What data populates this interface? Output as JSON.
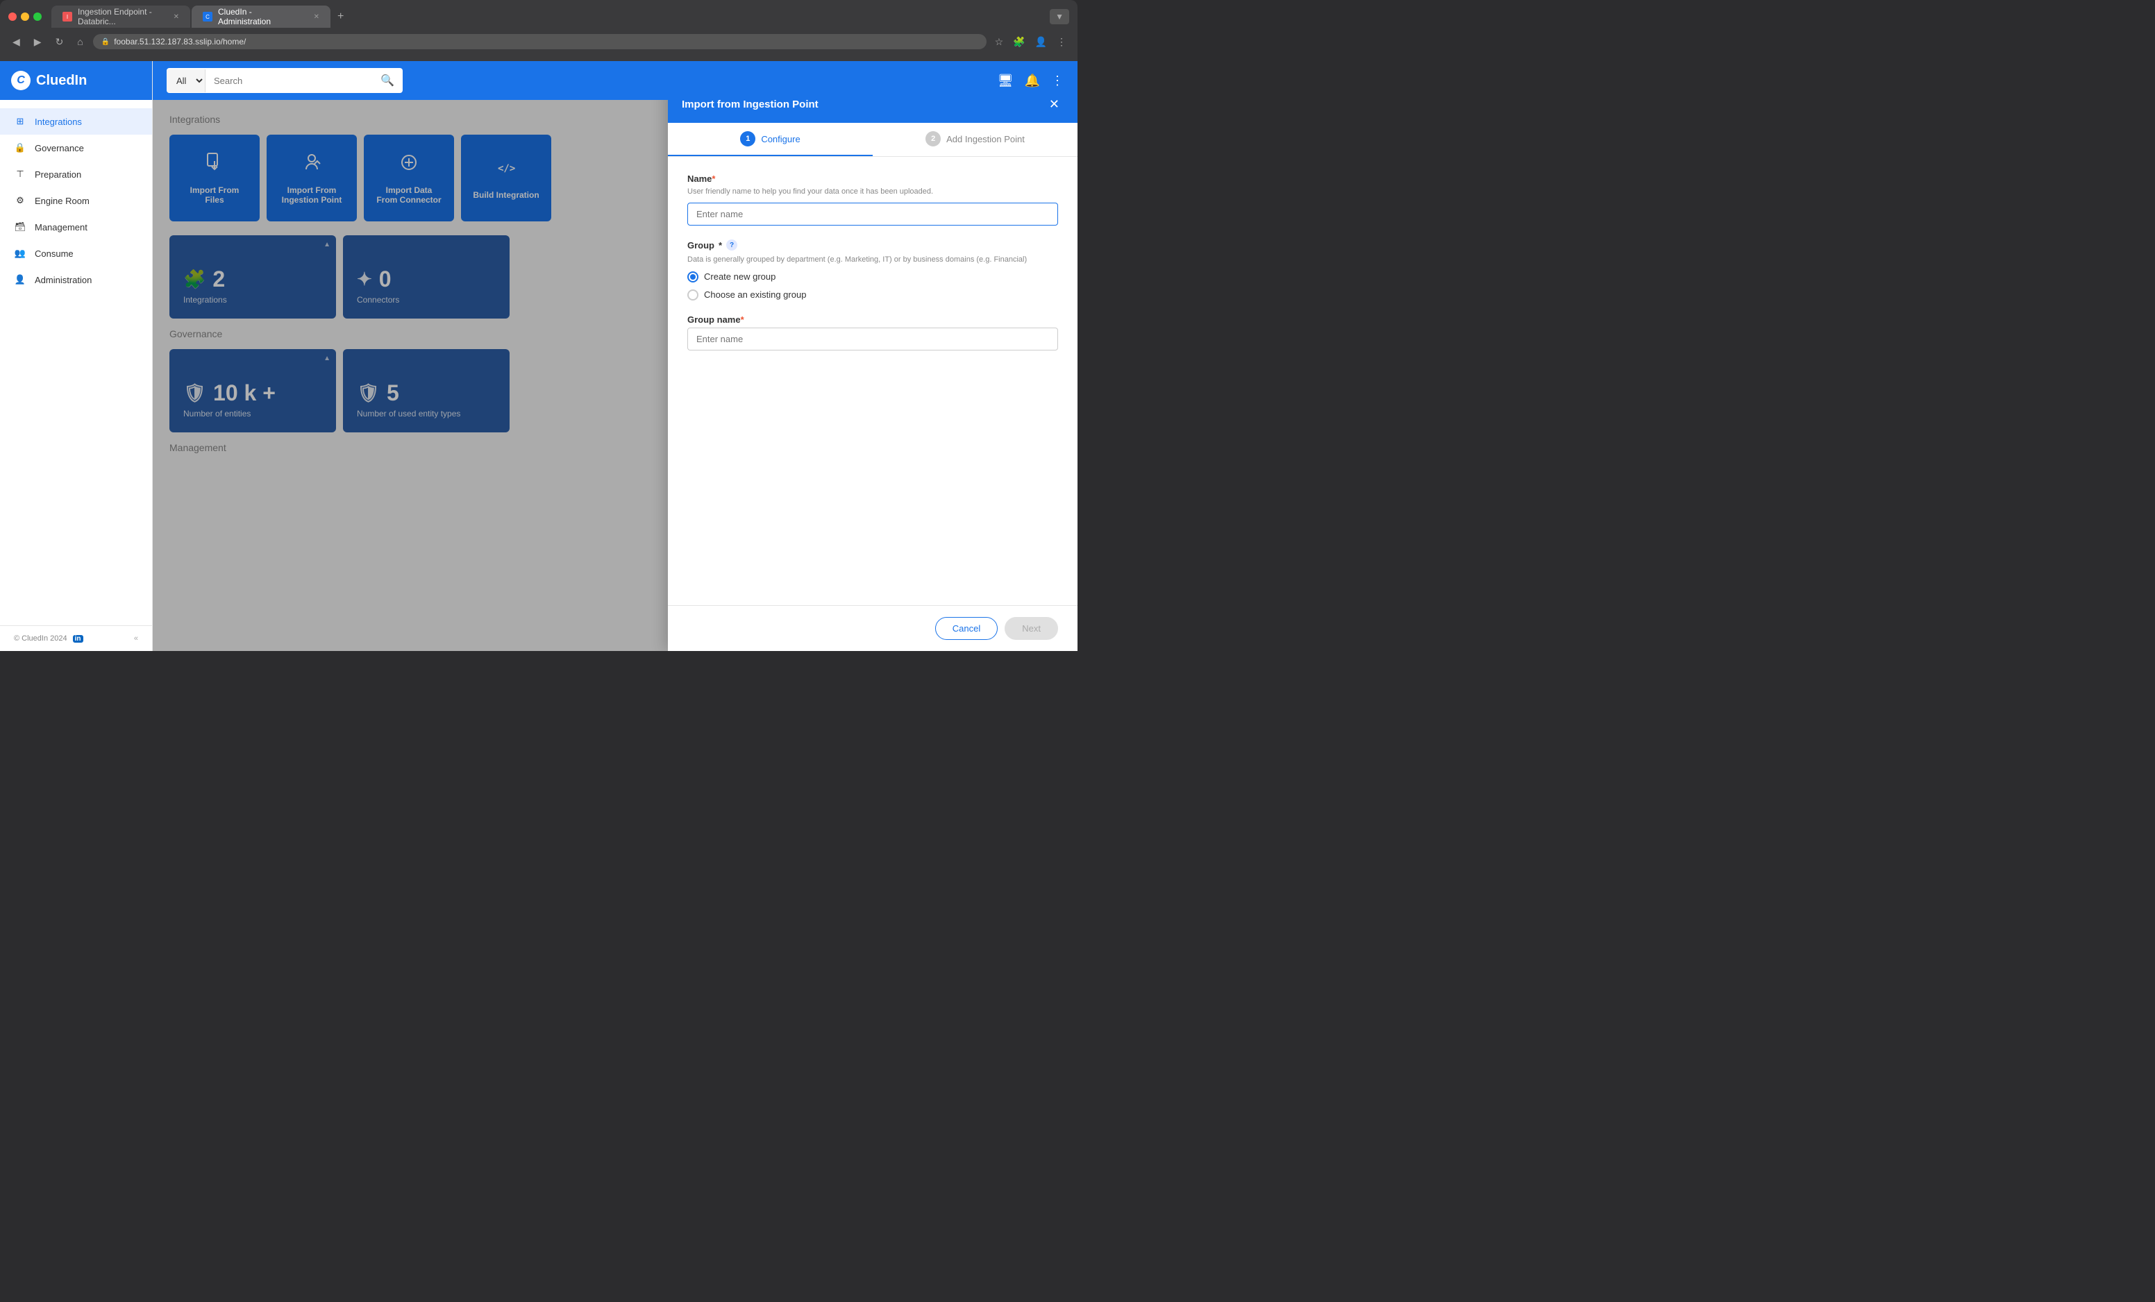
{
  "browser": {
    "tabs": [
      {
        "label": "Ingestion Endpoint - Databric...",
        "active": false,
        "icon": "red"
      },
      {
        "label": "CluedIn - Administration",
        "active": true,
        "icon": "blue"
      }
    ],
    "address": "foobar.51.132.187.83.sslip.io/home/",
    "new_tab_label": "+"
  },
  "topbar": {
    "logo": "CluedIn",
    "search_placeholder": "Search",
    "search_select_default": "All",
    "icons": [
      "monitor-icon",
      "bell-icon",
      "more-icon"
    ]
  },
  "sidebar": {
    "items": [
      {
        "label": "Integrations",
        "icon": "integrations-icon",
        "active": true
      },
      {
        "label": "Governance",
        "icon": "governance-icon"
      },
      {
        "label": "Preparation",
        "icon": "preparation-icon"
      },
      {
        "label": "Engine Room",
        "icon": "engine-icon"
      },
      {
        "label": "Management",
        "icon": "management-icon"
      },
      {
        "label": "Consume",
        "icon": "consume-icon"
      },
      {
        "label": "Administration",
        "icon": "admin-icon"
      }
    ],
    "footer": {
      "copyright": "© CluedIn 2024",
      "linkedin_icon": "linkedin-icon",
      "collapse_icon": "collapse-icon"
    }
  },
  "main": {
    "sections": [
      {
        "title": "Integrations",
        "integration_cards": [
          {
            "label": "Import From Files",
            "icon": "📄"
          },
          {
            "label": "Import From Ingestion Point",
            "icon": "📤"
          },
          {
            "label": "Import Data From Connector",
            "icon": "➕"
          },
          {
            "label": "Build Integration",
            "icon": "⟨/⟩"
          }
        ],
        "stat_cards": [
          {
            "count": "2",
            "label": "Integrations",
            "icon": "🧩",
            "has_corner": true
          },
          {
            "count": "0",
            "label": "Connectors",
            "icon": "🔗",
            "has_corner": false
          }
        ]
      },
      {
        "title": "Governance",
        "stat_cards": [
          {
            "count": "10 k +",
            "label": "Number of entities",
            "icon": "🛡",
            "has_corner": true
          },
          {
            "count": "5",
            "label": "Number of used entity types",
            "icon": "🛡",
            "has_corner": false
          }
        ]
      },
      {
        "title": "Management"
      }
    ]
  },
  "panel": {
    "title": "Import from Ingestion Point",
    "steps": [
      {
        "number": "1",
        "label": "Configure",
        "active": true
      },
      {
        "number": "2",
        "label": "Add Ingestion Point",
        "active": false
      }
    ],
    "form": {
      "name_label": "Name",
      "name_required": true,
      "name_hint": "User friendly name to help you find your data once it has been uploaded.",
      "name_placeholder": "Enter name",
      "group_label": "Group",
      "group_required": true,
      "group_hint": "Data is generally grouped by department (e.g. Marketing, IT) or by business domains (e.g. Financial)",
      "radio_options": [
        {
          "label": "Create new group",
          "checked": true
        },
        {
          "label": "Choose an existing group",
          "checked": false
        }
      ],
      "group_name_label": "Group name",
      "group_name_required": true,
      "group_name_placeholder": "Enter name"
    },
    "footer": {
      "cancel_label": "Cancel",
      "next_label": "Next"
    }
  }
}
